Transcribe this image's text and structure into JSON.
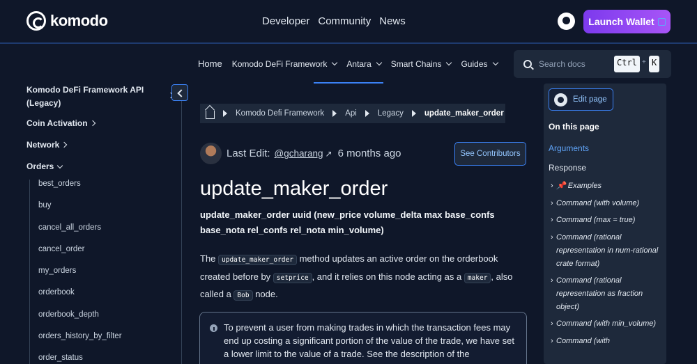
{
  "header": {
    "logo_text": "komodo",
    "nav": [
      "Developer",
      "Community",
      "News"
    ],
    "launch_label": "Launch Wallet"
  },
  "subnav": {
    "home": "Home",
    "items": [
      "Komodo DeFi Framework",
      "Antara",
      "Smart Chains",
      "Guides"
    ]
  },
  "search": {
    "placeholder": "Search docs",
    "key1": "Ctrl",
    "plus": "+",
    "key2": "K"
  },
  "sidebar": {
    "top_title": "Komodo DeFi Framework API (Legacy)",
    "sections": [
      "Coin Activation",
      "Network",
      "Orders"
    ],
    "order_items": [
      "best_orders",
      "buy",
      "cancel_all_orders",
      "cancel_order",
      "my_orders",
      "orderbook",
      "orderbook_depth",
      "orders_history_by_filter",
      "order_status"
    ]
  },
  "breadcrumb": {
    "items": [
      "Komodo Defi Framework",
      "Api",
      "Legacy"
    ],
    "current": "update_maker_order"
  },
  "author": {
    "label": "Last Edit:",
    "handle": "@gcharang",
    "arrow": "↗",
    "time": "6 months ago",
    "contributors_label": "See Contributors"
  },
  "content": {
    "title": "update_maker_order",
    "signature": "update_maker_order uuid (new_price volume_delta max base_confs base_nota rel_confs rel_nota min_volume)",
    "p_text1": "The ",
    "p_code1": "update_maker_order",
    "p_text2": " method updates an active order on the orderbook created before by ",
    "p_code2": "setprice",
    "p_text3": ", and it relies on this node acting as a ",
    "p_code3": "maker",
    "p_text4": ", also called a ",
    "p_code4": "Bob",
    "p_text5": " node.",
    "note": "To prevent a user from making trades in which the transaction fees may end up costing a significant portion of the value of the trade, we have set a lower limit to the value of a trade. See the description of the"
  },
  "toc": {
    "edit_label": "Edit page",
    "heading": "On this page",
    "arguments": "Arguments",
    "response": "Response",
    "items": [
      "📌 Examples",
      "Command (with volume)",
      "Command (max = true)",
      "Command (rational representation in num-rational crate format)",
      "Command (rational representation as fraction object)",
      "Command (with min_volume)",
      "Command (with"
    ]
  }
}
